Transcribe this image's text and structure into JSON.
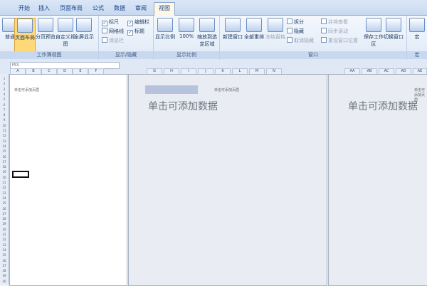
{
  "tabs": [
    "开始",
    "插入",
    "页面布局",
    "公式",
    "数据",
    "审阅",
    "视图"
  ],
  "active_tab": "视图",
  "groups": {
    "workbook_views": {
      "label": "工作簿视图",
      "buttons": [
        "普通",
        "页面布局",
        "分页预览",
        "自定义视图",
        "全屏显示"
      ]
    },
    "show_hide": {
      "label": "显示/隐藏",
      "checks": [
        {
          "label": "标尺",
          "checked": true
        },
        {
          "label": "编辑栏",
          "checked": true
        },
        {
          "label": "网格线",
          "checked": false
        },
        {
          "label": "标题",
          "checked": true
        },
        {
          "label": "消息栏",
          "checked": false
        }
      ]
    },
    "zoom": {
      "label": "显示比例",
      "buttons": [
        "显示比例",
        "100%",
        "缩放到选定区域"
      ]
    },
    "window": {
      "label": "窗口",
      "buttons": [
        "新建窗口",
        "全部重排",
        "冻结窗格"
      ],
      "small": [
        "拆分",
        "隐藏",
        "取消隐藏",
        "并排查看",
        "同步滚动",
        "重设窗口位置"
      ],
      "extra": [
        "保存工作区",
        "切换窗口"
      ]
    },
    "macro": {
      "label": "宏",
      "buttons": [
        "宏"
      ]
    }
  },
  "name_box": "F53",
  "column_headers": [
    "A",
    "B",
    "C",
    "D",
    "E",
    "F",
    "G",
    "H",
    "I",
    "J",
    "K",
    "L",
    "M",
    "N",
    "AA",
    "AB",
    "AC",
    "AD",
    "AE"
  ],
  "pages": [
    {
      "header": "单击可添加页眉",
      "placeholder": ""
    },
    {
      "header": "单击可添加页眉",
      "placeholder": "单击可添加数据"
    },
    {
      "header": "单击可添加页眉",
      "placeholder": "单击可添加数据"
    }
  ],
  "row_numbers": [
    "1",
    "2",
    "3",
    "4",
    "5",
    "6",
    "7",
    "8",
    "9",
    "10",
    "11",
    "12",
    "13",
    "14",
    "15",
    "16",
    "17",
    "18",
    "19",
    "20",
    "21",
    "22",
    "23",
    "24",
    "25",
    "26",
    "27",
    "28",
    "29",
    "30",
    "31",
    "32",
    "33",
    "34",
    "35",
    "36",
    "37",
    "38",
    "39",
    "40"
  ]
}
